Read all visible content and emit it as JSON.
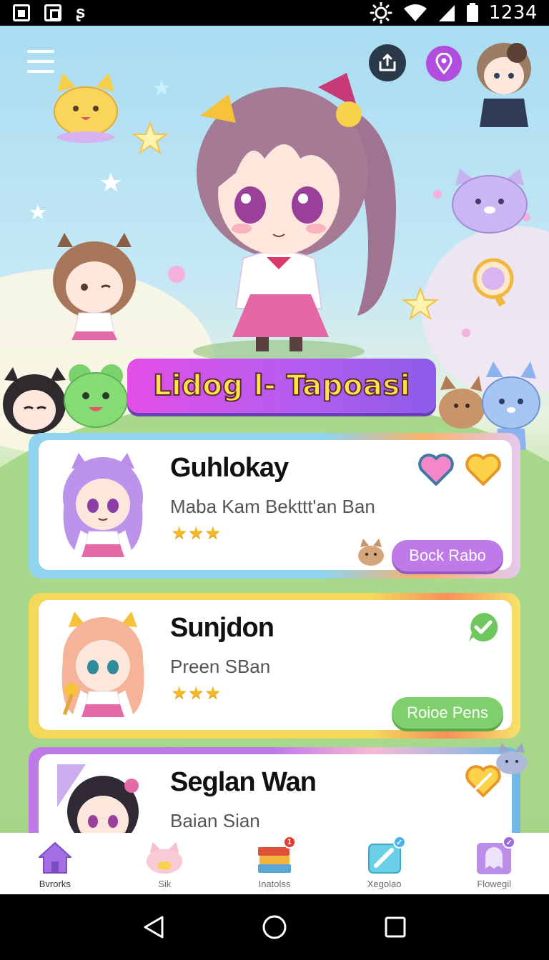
{
  "status_bar": {
    "time": "1234",
    "icons": [
      "notification-icon",
      "gallery-icon",
      "download-icon",
      "brightness-icon",
      "wifi-icon",
      "signal-icon",
      "battery-icon"
    ]
  },
  "header": {
    "menu_icon": "hamburger-menu-icon",
    "share_icon": "share-icon",
    "map_icon": "map-pin-icon"
  },
  "banner": {
    "title": "Lidog l- Tapoasi"
  },
  "cards": [
    {
      "name": "Guhlokay",
      "subtitle": "Maba Kam Bekttt'an Ban",
      "stars": "★★★",
      "action_label": "Bock Rabo",
      "favorite_icons": [
        "pink-heart-icon",
        "yellow-heart-icon"
      ],
      "accent": "#8fd3ee"
    },
    {
      "name": "Sunjdon",
      "subtitle": "Preen SBan",
      "stars": "★★★",
      "action_label": "Roioe Pens",
      "status_icon": "green-check-icon",
      "accent": "#f3d85a"
    },
    {
      "name": "Seglan Wan",
      "subtitle": "Baian Sian",
      "status_icon": "yellow-heart-icon",
      "accent": "#c07ae8"
    }
  ],
  "bottom_nav": {
    "items": [
      {
        "label": "Bvrorks",
        "icon": "home-icon"
      },
      {
        "label": "Sik",
        "icon": "cat-face-icon"
      },
      {
        "label": "Inatolss",
        "icon": "books-icon",
        "badge": "1"
      },
      {
        "label": "Xegolao",
        "icon": "tag-icon",
        "badge": "✓"
      },
      {
        "label": "Flowegil",
        "icon": "ghost-icon",
        "badge": "✓"
      }
    ]
  },
  "system_nav": {
    "back_icon": "back-triangle-icon",
    "home_icon": "home-circle-icon",
    "recents_icon": "recents-square-icon"
  },
  "colors": {
    "banner_start": "#e34fe6",
    "banner_end": "#8c5ce8",
    "banner_text": "#ffe24a",
    "button_purple": "#c07ae8",
    "button_green": "#7fcf6c"
  }
}
